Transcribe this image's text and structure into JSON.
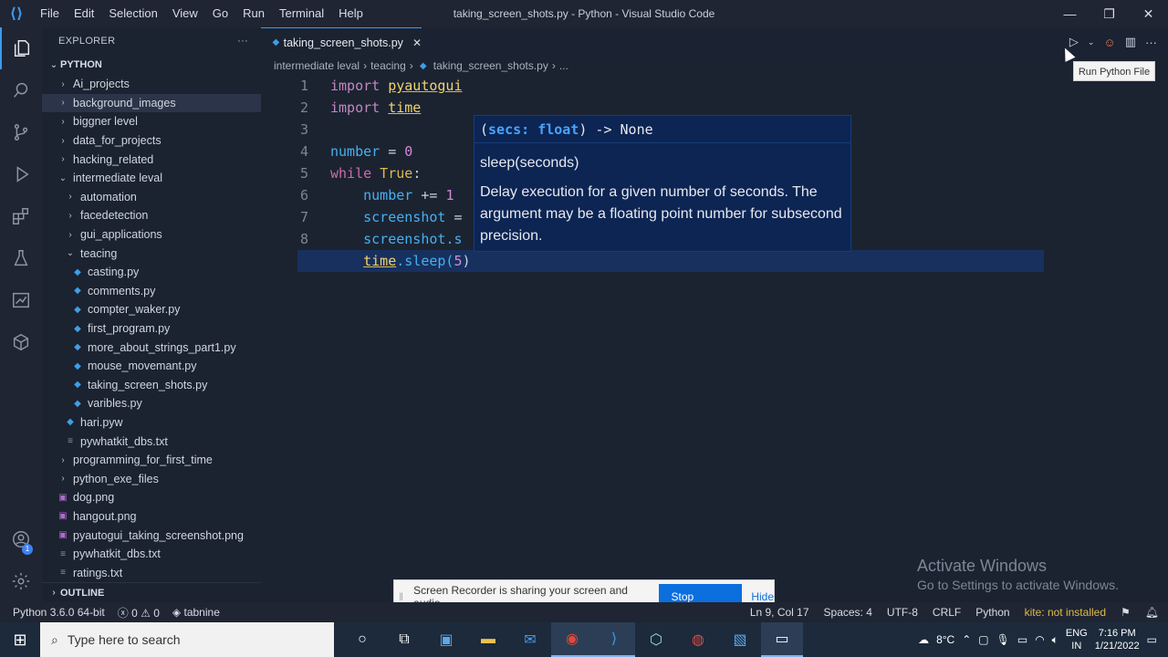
{
  "titlebar": {
    "menu": [
      "File",
      "Edit",
      "Selection",
      "View",
      "Go",
      "Run",
      "Terminal",
      "Help"
    ],
    "title": "taking_screen_shots.py - Python - Visual Studio Code"
  },
  "sidebar": {
    "header": "EXPLORER",
    "section": "PYTHON",
    "items": [
      {
        "label": "Ai_projects",
        "kind": "folder",
        "depth": 1,
        "open": false
      },
      {
        "label": "background_images",
        "kind": "folder",
        "depth": 1,
        "open": false
      },
      {
        "label": "biggner level",
        "kind": "folder",
        "depth": 1,
        "open": false
      },
      {
        "label": "data_for_projects",
        "kind": "folder",
        "depth": 1,
        "open": false
      },
      {
        "label": "hacking_related",
        "kind": "folder",
        "depth": 1,
        "open": false
      },
      {
        "label": "intermediate leval",
        "kind": "folder",
        "depth": 1,
        "open": true
      },
      {
        "label": "automation",
        "kind": "folder",
        "depth": 2,
        "open": false
      },
      {
        "label": "facedetection",
        "kind": "folder",
        "depth": 2,
        "open": false
      },
      {
        "label": "gui_applications",
        "kind": "folder",
        "depth": 2,
        "open": false
      },
      {
        "label": "teacing",
        "kind": "folder",
        "depth": 2,
        "open": true
      },
      {
        "label": "casting.py",
        "kind": "py",
        "depth": 3
      },
      {
        "label": "comments.py",
        "kind": "py",
        "depth": 3
      },
      {
        "label": "compter_waker.py",
        "kind": "py",
        "depth": 3
      },
      {
        "label": "first_program.py",
        "kind": "py",
        "depth": 3
      },
      {
        "label": "more_about_strings_part1.py",
        "kind": "py",
        "depth": 3
      },
      {
        "label": "mouse_movemant.py",
        "kind": "py",
        "depth": 3
      },
      {
        "label": "taking_screen_shots.py",
        "kind": "py",
        "depth": 3
      },
      {
        "label": "varibles.py",
        "kind": "py",
        "depth": 3
      },
      {
        "label": "hari.pyw",
        "kind": "py",
        "depth": 2
      },
      {
        "label": "pywhatkit_dbs.txt",
        "kind": "txt",
        "depth": 2
      },
      {
        "label": "programming_for_first_time",
        "kind": "folder",
        "depth": 1,
        "open": false
      },
      {
        "label": "python_exe_files",
        "kind": "folder",
        "depth": 1,
        "open": false
      },
      {
        "label": "dog.png",
        "kind": "img",
        "depth": 1
      },
      {
        "label": "hangout.png",
        "kind": "img",
        "depth": 1
      },
      {
        "label": "pyautogui_taking_screenshot.png",
        "kind": "img",
        "depth": 1
      },
      {
        "label": "pywhatkit_dbs.txt",
        "kind": "txt",
        "depth": 1
      },
      {
        "label": "ratings.txt",
        "kind": "txt",
        "depth": 1
      }
    ],
    "outline": "OUTLINE"
  },
  "editor": {
    "tab": "taking_screen_shots.py",
    "breadcrumb": [
      "intermediate leval",
      "teacing",
      "taking_screen_shots.py",
      "..."
    ],
    "lines": [
      "1",
      "2",
      "3",
      "4",
      "5",
      "6",
      "7",
      "8",
      "9"
    ]
  },
  "code": {
    "l1_kw": "import",
    "l1_mod": "pyautogui",
    "l2_kw": "import",
    "l2_mod": "time",
    "l4_var": "number",
    "l4_op": " = ",
    "l4_num": "0",
    "l5_kw": "while",
    "l5_true": " True",
    "l5_colon": ":",
    "l6_var": "number",
    "l6_op": " += ",
    "l6_num": "1",
    "l7_var": "screenshot",
    "l7_op": " =",
    "l8_var": "screenshot",
    "l8_rest": ".s",
    "l9_mod": "time",
    "l9_rest": ".sleep(",
    "l9_num": "5",
    "l9_close": ")"
  },
  "hover": {
    "sig_open": "(",
    "sig_param": "secs: float",
    "sig_close": ") -> None",
    "title": "sleep(seconds)",
    "desc": "Delay execution for a given number of seconds. The argument may be a floating point number for subsecond precision."
  },
  "run_tooltip": "Run Python File",
  "watermark": {
    "title": "Activate Windows",
    "sub": "Go to Settings to activate Windows."
  },
  "recorder": {
    "message": "Screen Recorder is sharing your screen and audio.",
    "stop": "Stop sharing",
    "hide": "Hide"
  },
  "statusbar": {
    "interpreter": "Python 3.6.0 64-bit",
    "errors": "0",
    "warnings": "0",
    "tabnine": "tabnine",
    "position": "Ln 9, Col 17",
    "spaces": "Spaces: 4",
    "encoding": "UTF-8",
    "eol": "CRLF",
    "language": "Python",
    "kite": "kite: not installed"
  },
  "taskbar": {
    "search_placeholder": "Type here to search",
    "weather": "8°C",
    "lang": "ENG",
    "region": "IN",
    "time": "7:16 PM",
    "date": "1/21/2022"
  }
}
